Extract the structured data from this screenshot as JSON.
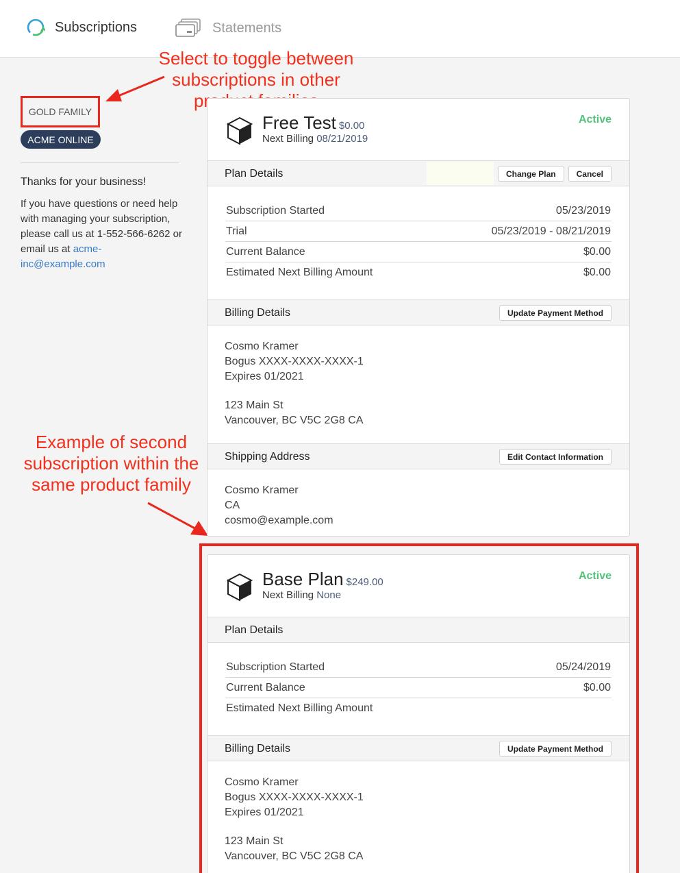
{
  "nav": {
    "tabs": [
      {
        "label": "Subscriptions",
        "icon": "refresh-icon",
        "active": true
      },
      {
        "label": "Statements",
        "icon": "card-stack-icon",
        "active": false
      }
    ]
  },
  "sidebar": {
    "family_label": "GOLD FAMILY",
    "product_pill": "ACME ONLINE",
    "thanks": "Thanks for your business!",
    "help_text": "If you have questions or need help with managing your subscription, please call us at 1-552-566-6262 or email us at",
    "email": "acme-inc@example.com"
  },
  "annotations": {
    "toggle_note": "Select to toggle between subscriptions in other product families",
    "second_sub_note": "Example of second subscription within the same product family"
  },
  "subscriptions": [
    {
      "name": "Free Test",
      "price": "$0.00",
      "next_billing_label": "Next Billing",
      "next_billing": "08/21/2019",
      "status": "Active",
      "plan_details": {
        "title": "Plan Details",
        "buttons": [
          "Change Plan",
          "Cancel"
        ],
        "rows": [
          {
            "label": "Subscription Started",
            "value": "05/23/2019"
          },
          {
            "label": "Trial",
            "value": "05/23/2019 - 08/21/2019"
          },
          {
            "label": "Current Balance",
            "value": "$0.00"
          },
          {
            "label": "Estimated Next Billing Amount",
            "value": "$0.00"
          }
        ]
      },
      "billing": {
        "title": "Billing Details",
        "button": "Update Payment Method",
        "name": "Cosmo Kramer",
        "card": "Bogus XXXX-XXXX-XXXX-1",
        "expires": "Expires 01/2021",
        "street": "123 Main St",
        "city": "Vancouver, BC V5C 2G8 CA"
      },
      "shipping": {
        "title": "Shipping Address",
        "button": "Edit Contact Information",
        "name": "Cosmo Kramer",
        "country": "CA",
        "email": "cosmo@example.com"
      }
    },
    {
      "name": "Base Plan",
      "price": "$249.00",
      "next_billing_label": "Next Billing",
      "next_billing": "None",
      "status": "Active",
      "plan_details": {
        "title": "Plan Details",
        "rows": [
          {
            "label": "Subscription Started",
            "value": "05/24/2019"
          },
          {
            "label": "Current Balance",
            "value": "$0.00"
          },
          {
            "label": "Estimated Next Billing Amount",
            "value": ""
          }
        ]
      },
      "billing": {
        "title": "Billing Details",
        "button": "Update Payment Method",
        "name": "Cosmo Kramer",
        "card": "Bogus XXXX-XXXX-XXXX-1",
        "expires": "Expires 01/2021",
        "street": "123 Main St",
        "city": "Vancouver, BC V5C 2G8 CA"
      }
    }
  ],
  "colors": {
    "accent_active": "#53c178",
    "pill_bg": "#2c3e5c",
    "annotation_red": "#e8281e",
    "link": "#3879c6"
  }
}
